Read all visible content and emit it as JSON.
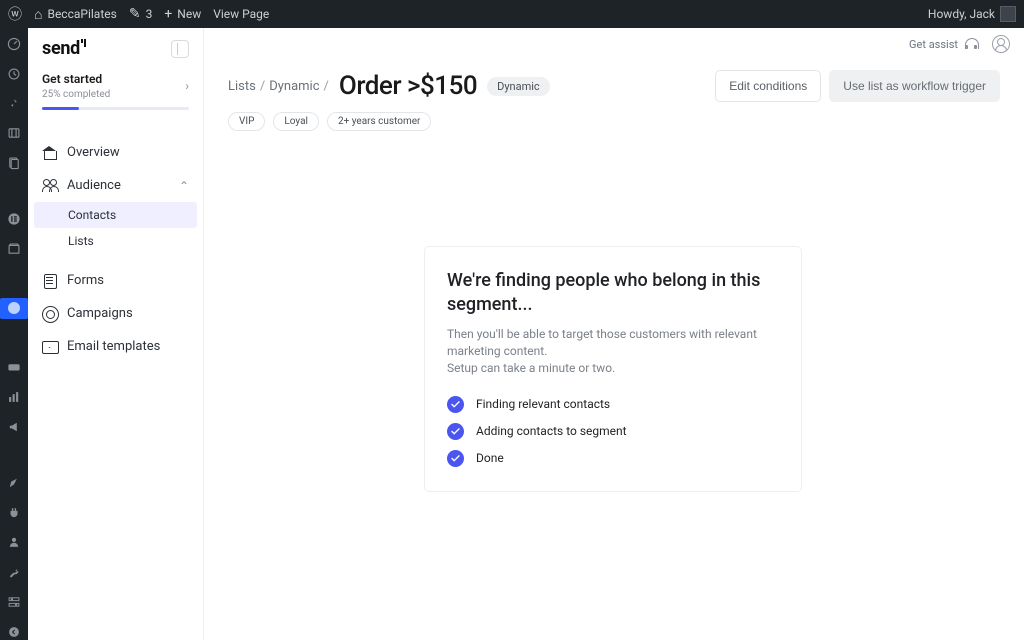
{
  "wpbar": {
    "site_name": "BeccaPilates",
    "edit_count": "3",
    "new_label": "New",
    "view_page_label": "View Page",
    "greeting": "Howdy, Jack"
  },
  "sidebar": {
    "logo_text": "send",
    "getstarted": {
      "title": "Get started",
      "subtitle": "25% completed",
      "progress_percent": 25
    },
    "items": {
      "overview": "Overview",
      "audience": "Audience",
      "contacts": "Contacts",
      "lists": "Lists",
      "forms": "Forms",
      "campaigns": "Campaigns",
      "email_templates": "Email templates"
    }
  },
  "topbar": {
    "assist_label": "Get assist"
  },
  "breadcrumb": {
    "level1": "Lists",
    "level2": "Dynamic"
  },
  "page": {
    "title": "Order >$150",
    "type_pill": "Dynamic",
    "tags": [
      "VIP",
      "Loyal",
      "2+ years  customer"
    ]
  },
  "buttons": {
    "edit": "Edit conditions",
    "workflow": "Use list as workflow trigger"
  },
  "card": {
    "heading": "We're finding people who belong in this segment...",
    "line1": "Then you'll be able to target those customers with relevant marketing content.",
    "line2": "Setup can take a minute or two.",
    "steps": [
      "Finding relevant contacts",
      "Adding contacts to segment",
      "Done"
    ]
  },
  "colors": {
    "accent": "#4b56f0"
  }
}
